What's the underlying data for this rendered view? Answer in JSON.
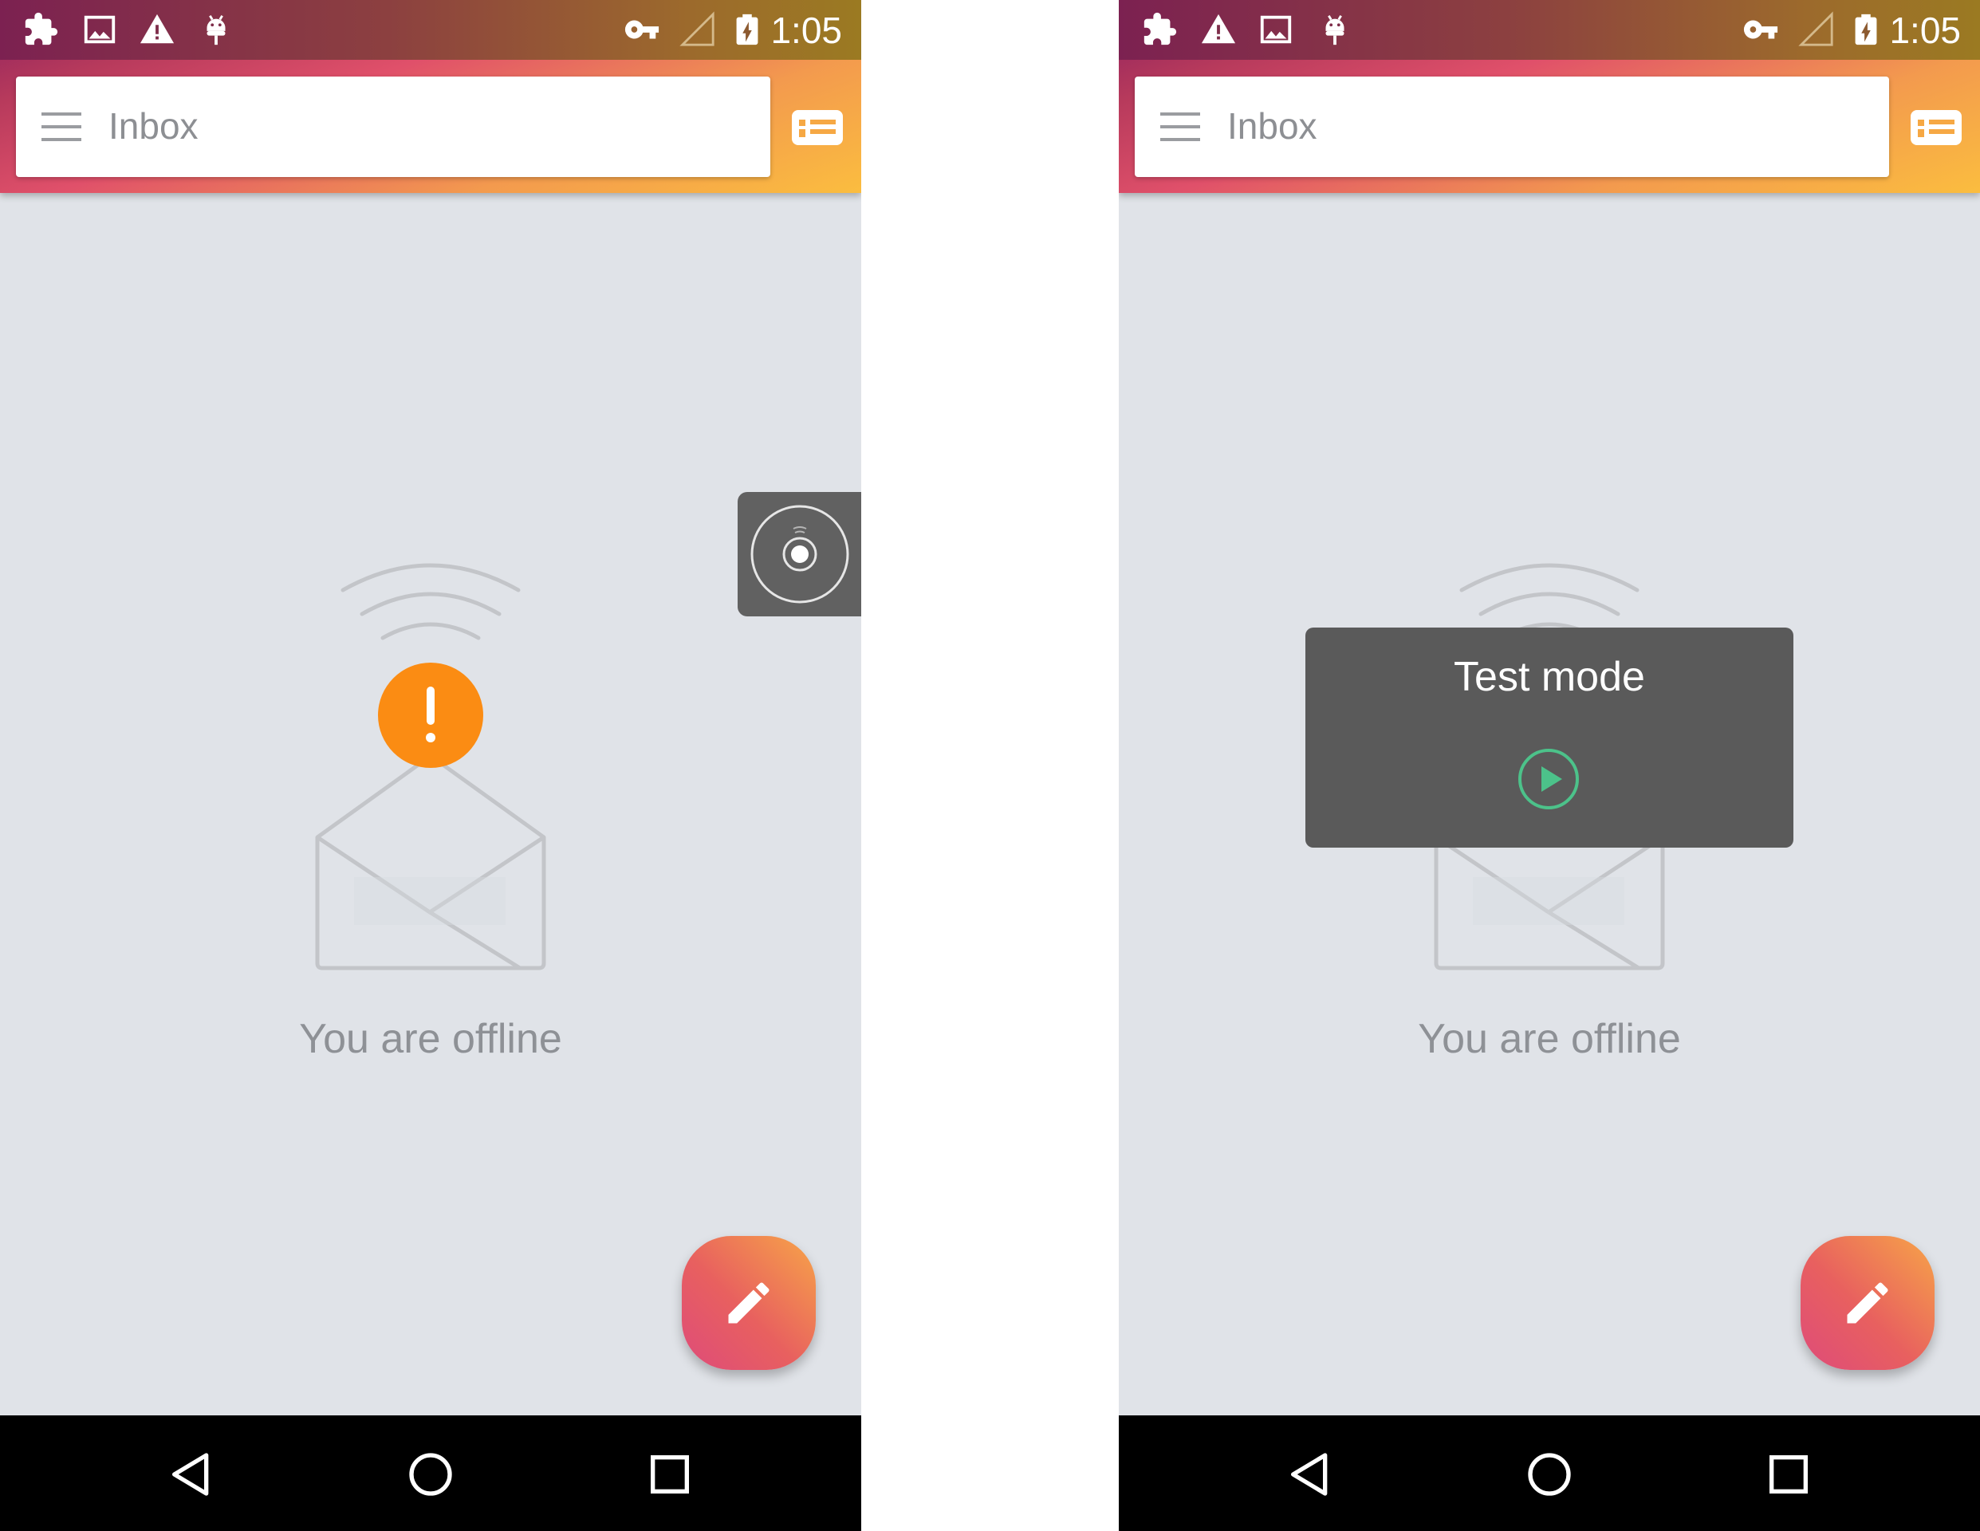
{
  "screens": [
    {
      "status_bar": {
        "time": "1:05",
        "left_icons": [
          "puzzle-icon",
          "image-icon",
          "warning-icon",
          "android-debug-icon"
        ],
        "right_icons": [
          "vpn-key-icon",
          "no-signal-icon",
          "battery-charging-icon"
        ]
      },
      "search": {
        "label": "Inbox"
      },
      "empty_state": {
        "message": "You are offline"
      },
      "overlay": {
        "type": "floating-tool-bubble"
      }
    },
    {
      "status_bar": {
        "time": "1:05",
        "left_icons": [
          "puzzle-icon",
          "warning-icon",
          "image-icon",
          "android-debug-icon"
        ],
        "right_icons": [
          "vpn-key-icon",
          "no-signal-icon",
          "battery-charging-icon"
        ]
      },
      "search": {
        "label": "Inbox"
      },
      "empty_state": {
        "message": "You are offline"
      },
      "toast": {
        "title": "Test mode"
      }
    }
  ],
  "colors": {
    "accent_orange": "#fb8c13",
    "background": "#e0e3e8",
    "fab_gradient_start": "#f7a548",
    "fab_gradient_end": "#de4b7a",
    "toast_play_green": "#4cc28a"
  }
}
